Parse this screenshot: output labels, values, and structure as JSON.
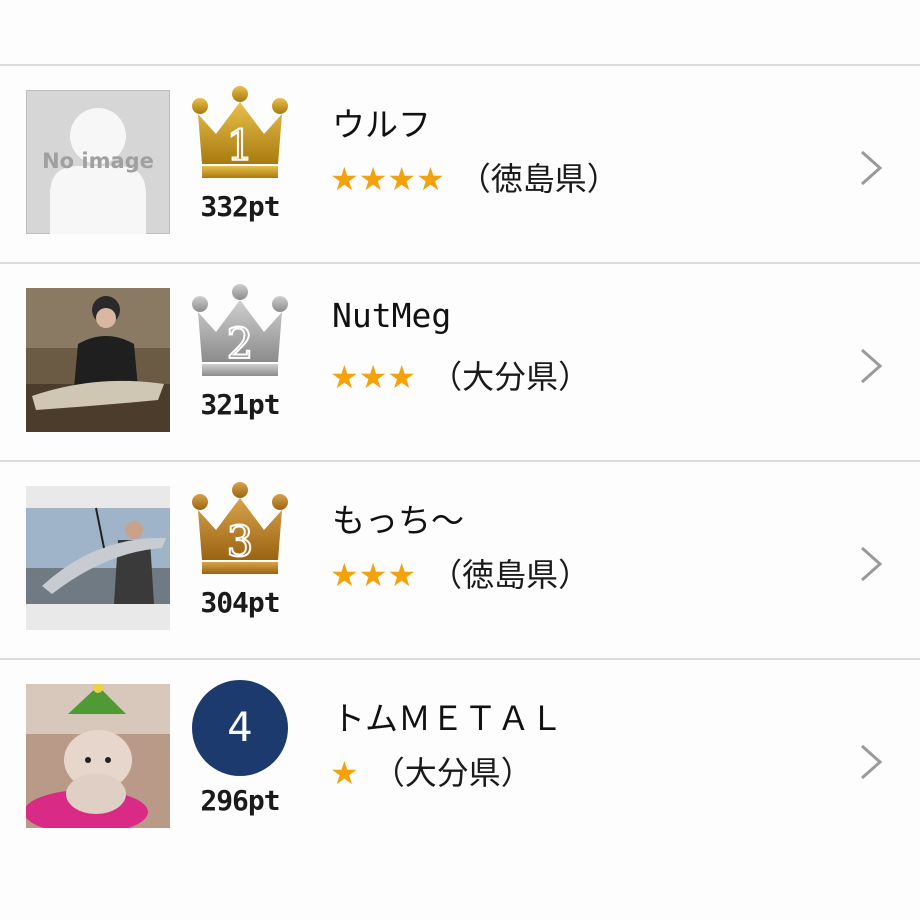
{
  "colors": {
    "gold": "#c99a1c",
    "silver": "#a8a8a8",
    "bronze": "#a8741c",
    "star": "#f3a20b",
    "rank_circle": "#1d3a6e"
  },
  "ranking": [
    {
      "rank": "1",
      "badge": "gold-crown-icon",
      "points": "332pt",
      "name": "ウルフ",
      "stars": "★★★★",
      "star_count": 4,
      "prefecture": "（徳島県）",
      "avatar": "no-image-placeholder",
      "no_image_text": "No image"
    },
    {
      "rank": "2",
      "badge": "silver-crown-icon",
      "points": "321pt",
      "name": "NutMeg",
      "stars": "★★★",
      "star_count": 3,
      "prefecture": "（大分県）",
      "avatar": "angler-photo"
    },
    {
      "rank": "3",
      "badge": "bronze-crown-icon",
      "points": "304pt",
      "name": "もっち～",
      "stars": "★★★",
      "star_count": 3,
      "prefecture": "（徳島県）",
      "avatar": "fish-catch-photo"
    },
    {
      "rank": "4",
      "badge": "rank-circle",
      "points": "296pt",
      "name": "トムＭＥＴＡＬ",
      "stars": "★",
      "star_count": 1,
      "prefecture": "（大分県）",
      "avatar": "dog-photo"
    }
  ]
}
